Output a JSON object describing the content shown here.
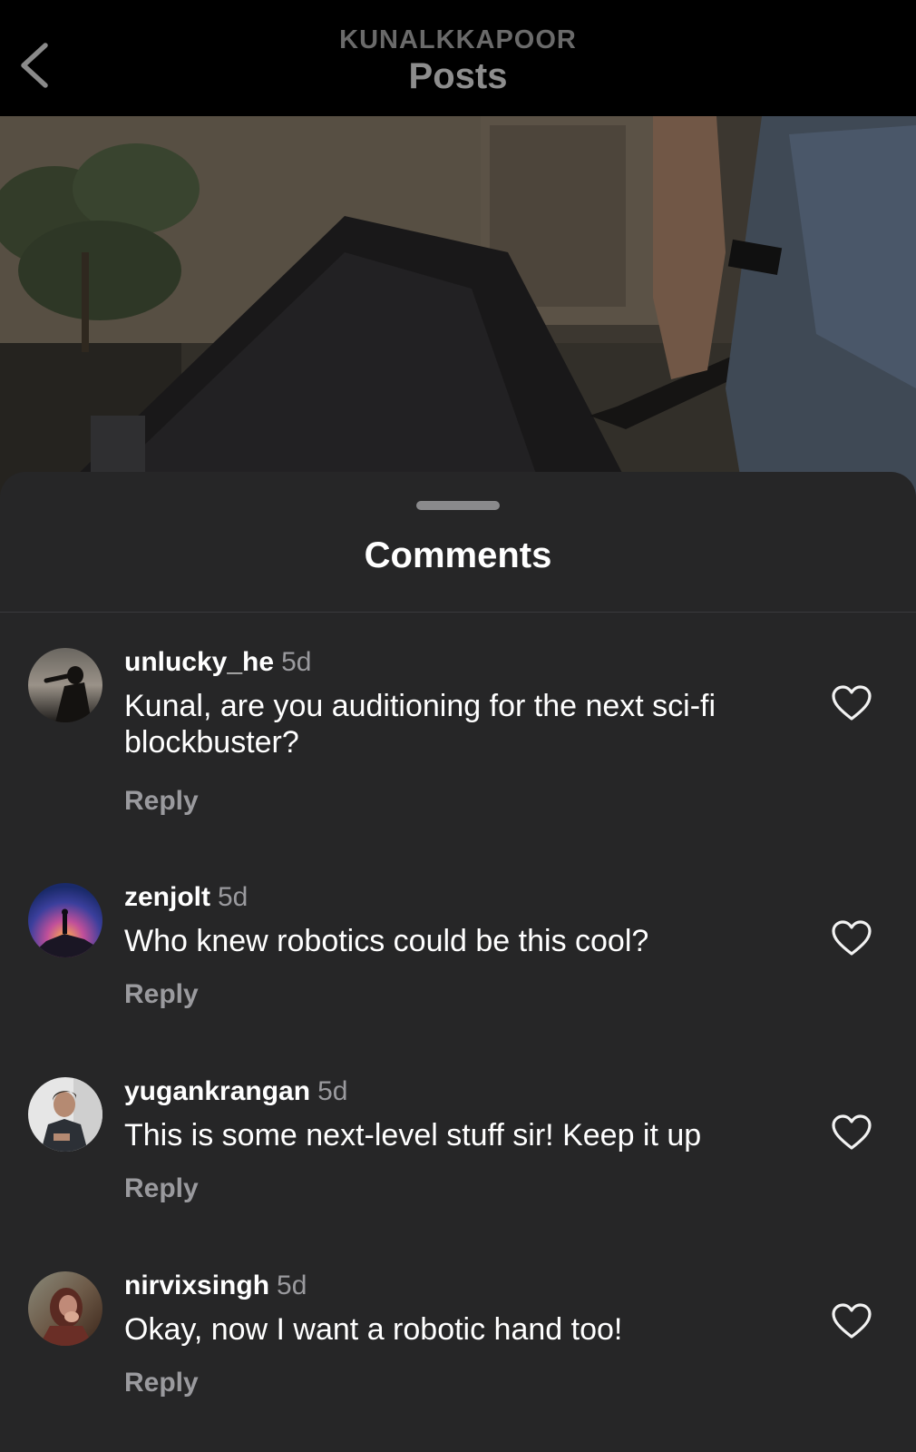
{
  "header": {
    "account": "KUNALKKAPOOR",
    "title": "Posts"
  },
  "icons": {
    "back": "chevron-left-icon",
    "like": "heart-outline-icon"
  },
  "sheet": {
    "title": "Comments"
  },
  "comments": [
    {
      "username": "unlucky_he",
      "time": "5d",
      "text": "Kunal, are you auditioning for the next sci-fi blockbuster?",
      "reply": "Reply"
    },
    {
      "username": "zenjolt",
      "time": "5d",
      "text": "Who knew robotics could be this cool?",
      "reply": "Reply"
    },
    {
      "username": "yugankrangan",
      "time": "5d",
      "text": "This is some next-level stuff sir! Keep it up",
      "reply": "Reply"
    },
    {
      "username": "nirvixsingh",
      "time": "5d",
      "text": "Okay, now I want a robotic hand too!",
      "reply": "Reply"
    }
  ],
  "colors": {
    "sheet_background": "#262627",
    "primary_text": "#ffffff",
    "secondary_text": "#9a9a9e"
  }
}
